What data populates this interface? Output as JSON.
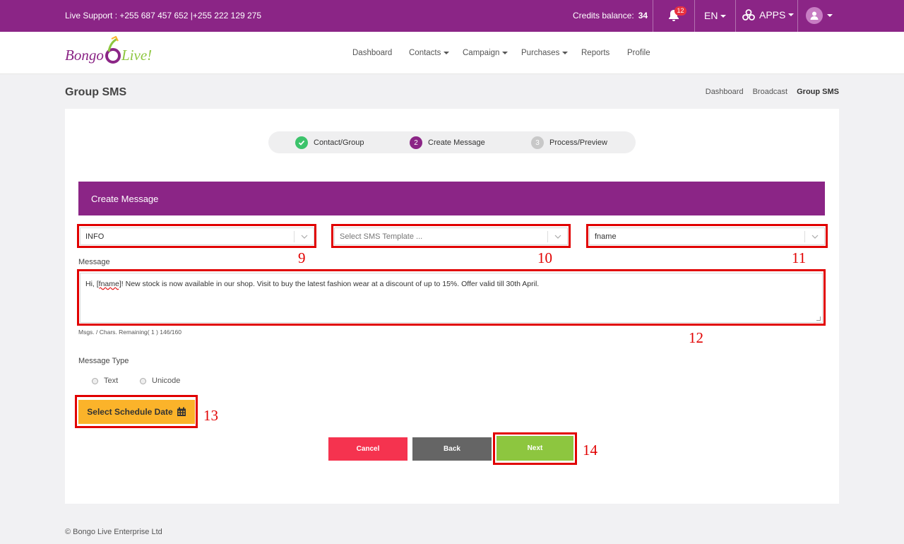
{
  "topbar": {
    "support_text": "Live Support : +255 687 457 652 |+255 222 129 275",
    "credits_label": "Credits balance:",
    "credits_value": "34",
    "notifications_count": "12",
    "language": "EN",
    "apps_label": "APPS",
    "bg_color": "#8b2586"
  },
  "brand": {
    "logo_text_1": "Bongo",
    "logo_text_2": "Live!"
  },
  "nav": {
    "items": [
      "Dashboard",
      "Contacts",
      "Campaign",
      "Purchases",
      "Reports",
      "Profile"
    ]
  },
  "page": {
    "title": "Group SMS",
    "breadcrumbs": [
      "Dashboard",
      "Broadcast",
      "Group SMS"
    ]
  },
  "stepper": {
    "steps": [
      {
        "label": "Contact/Group",
        "state": "done",
        "number": "1"
      },
      {
        "label": "Create Message",
        "state": "active",
        "number": "2"
      },
      {
        "label": "Process/Preview",
        "state": "pending",
        "number": "3"
      }
    ]
  },
  "form": {
    "header": "Create Message",
    "sender_value": "INFO",
    "template_placeholder": "Select SMS Template ...",
    "field_value": "fname",
    "message_label": "Message",
    "message_before": "Hi, ",
    "message_token": "[fname]",
    "message_after": "! New stock is now available in our shop. Visit to buy the latest fashion wear at a discount of up to 15%. Offer valid till 30th April.",
    "counter": "Msgs. / Chars. Remaining( 1 ) 146/160",
    "message_type_label": "Message Type",
    "type_options": [
      "Text",
      "Unicode"
    ],
    "schedule_button": "Select Schedule Date",
    "cancel_button": "Cancel",
    "back_button": "Back",
    "next_button": "Next"
  },
  "annotations": [
    "9",
    "10",
    "11",
    "12",
    "13",
    "14"
  ],
  "footer": {
    "copyright": "© Bongo Live Enterprise Ltd"
  },
  "colors": {
    "accent": "#8b2586",
    "cancel": "#f5334f",
    "back": "#656565",
    "next": "#8dc63f",
    "schedule": "#fbb32a",
    "highlight": "#e10000",
    "step_done": "#3cc36b"
  }
}
